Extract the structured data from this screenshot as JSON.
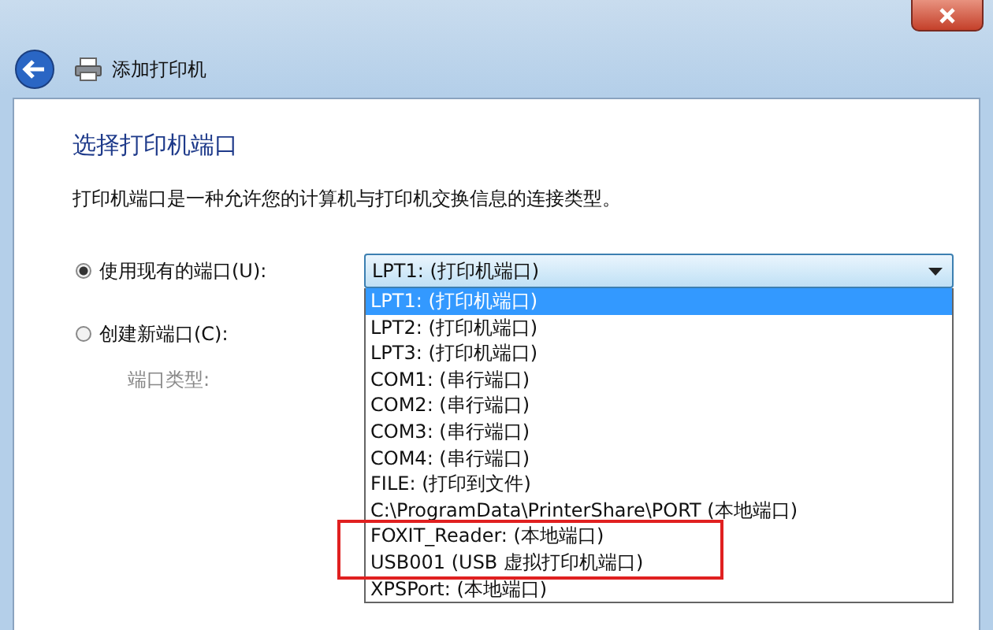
{
  "window": {
    "title": "添加打印机"
  },
  "page": {
    "heading": "选择打印机端口",
    "description": "打印机端口是一种允许您的计算机与打印机交换信息的连接类型。"
  },
  "options": [
    {
      "label": "使用现有的端口(U):",
      "selected": true
    },
    {
      "label": "创建新端口(C):",
      "selected": false
    }
  ],
  "port_type": {
    "label": "端口类型:",
    "disabled": true
  },
  "combo": {
    "value": "LPT1: (打印机端口)",
    "expanded": true
  },
  "ports": [
    {
      "label": "LPT1: (打印机端口)",
      "selected": true,
      "highlighted": false
    },
    {
      "label": "LPT2: (打印机端口)",
      "selected": false,
      "highlighted": false
    },
    {
      "label": "LPT3: (打印机端口)",
      "selected": false,
      "highlighted": false
    },
    {
      "label": "COM1: (串行端口)",
      "selected": false,
      "highlighted": false
    },
    {
      "label": "COM2: (串行端口)",
      "selected": false,
      "highlighted": false
    },
    {
      "label": "COM3: (串行端口)",
      "selected": false,
      "highlighted": false
    },
    {
      "label": "COM4: (串行端口)",
      "selected": false,
      "highlighted": false
    },
    {
      "label": "FILE: (打印到文件)",
      "selected": false,
      "highlighted": false
    },
    {
      "label": "C:\\ProgramData\\PrinterShare\\PORT (本地端口)",
      "selected": false,
      "highlighted": false
    },
    {
      "label": "FOXIT_Reader: (本地端口)",
      "selected": false,
      "highlighted": true
    },
    {
      "label": "USB001 (USB 虚拟打印机端口)",
      "selected": false,
      "highlighted": true
    },
    {
      "label": "XPSPort: (本地端口)",
      "selected": false,
      "highlighted": false
    }
  ]
}
